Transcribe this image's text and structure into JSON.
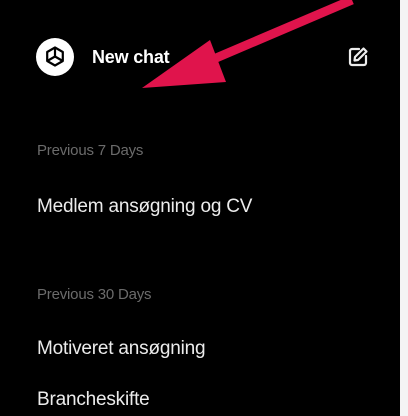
{
  "header": {
    "new_chat_label": "New chat",
    "logo_icon": "openai-logo-icon",
    "edit_icon": "edit-pencil-icon"
  },
  "sections": [
    {
      "heading": "Previous 7 Days",
      "items": [
        "Medlem ansøgning og CV"
      ]
    },
    {
      "heading": "Previous 30 Days",
      "items": [
        "Motiveret ansøgning",
        "Brancheskifte"
      ]
    }
  ],
  "annotation": {
    "arrow_color": "#e0144c"
  },
  "colors": {
    "background": "#000000",
    "text": "#ececec",
    "muted": "#6b6b6b"
  }
}
